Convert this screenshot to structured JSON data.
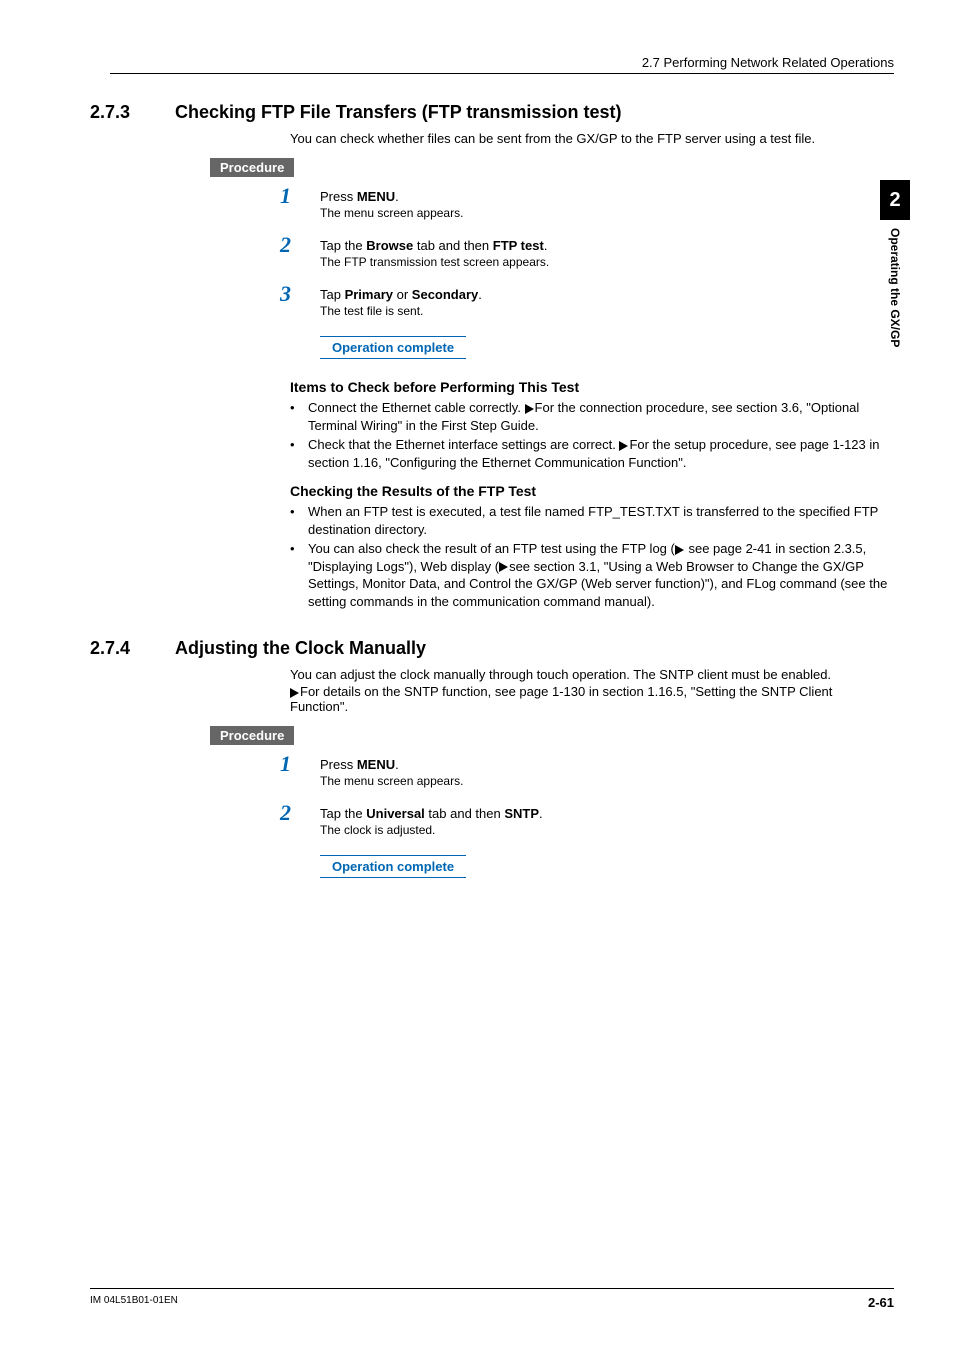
{
  "header": {
    "section_label": "2.7  Performing Network Related Operations"
  },
  "side_tab": {
    "number": "2",
    "text": "Operating the GX/GP"
  },
  "sec273": {
    "num": "2.7.3",
    "title": "Checking FTP File Transfers (FTP transmission test)",
    "intro": "You can check whether files can be sent from the GX/GP to the FTP server using a test file.",
    "procedure_label": "Procedure",
    "steps": [
      {
        "n": "1",
        "main_pre": "Press ",
        "main_bold": "MENU",
        "main_post": ".",
        "sub": "The menu screen appears."
      },
      {
        "n": "2",
        "main_pre": "Tap the ",
        "main_bold": "Browse",
        "main_mid": " tab and then ",
        "main_bold2": "FTP test",
        "main_post": ".",
        "sub": "The FTP transmission test screen appears."
      },
      {
        "n": "3",
        "main_pre": "Tap ",
        "main_bold": "Primary",
        "main_mid": " or ",
        "main_bold2": "Secondary",
        "main_post": ".",
        "sub": "The test file is sent."
      }
    ],
    "op_complete": "Operation complete",
    "check_before_head": "Items to Check before Performing This Test",
    "check_before": [
      "Connect the Ethernet cable correctly. ▶For the connection procedure, see section 3.6, \"Optional Terminal Wiring\" in the First Step Guide.",
      "Check that the Ethernet interface settings are correct. ▶For the setup procedure, see page 1-123 in section 1.16, \"Configuring the Ethernet Communication Function\"."
    ],
    "check_results_head": "Checking the Results of the FTP Test",
    "check_results": [
      "When an FTP test is executed, a test file named FTP_TEST.TXT is transferred to the specified FTP destination directory.",
      "You can also check the result of an FTP test using the FTP log (▶ see page 2-41 in section 2.3.5, \"Displaying Logs\"), Web display (▶see section 3.1, \"Using a Web Browser to Change the GX/GP Settings, Monitor Data, and Control the GX/GP (Web server function)\"), and FLog command (see the setting commands in the communication command manual)."
    ]
  },
  "sec274": {
    "num": "2.7.4",
    "title": "Adjusting the Clock Manually",
    "intro1": "You can adjust the clock manually through touch operation. The SNTP client must be enabled.",
    "intro2": "▶For details on the SNTP function, see page 1-130 in section 1.16.5, \"Setting the SNTP Client Function\".",
    "procedure_label": "Procedure",
    "steps": [
      {
        "n": "1",
        "main_pre": "Press ",
        "main_bold": "MENU",
        "main_post": ".",
        "sub": "The menu screen appears."
      },
      {
        "n": "2",
        "main_pre": "Tap the ",
        "main_bold": "Universal",
        "main_mid": " tab and then ",
        "main_bold2": "SNTP",
        "main_post": ".",
        "sub": "The clock is adjusted."
      }
    ],
    "op_complete": "Operation complete"
  },
  "footer": {
    "left": "IM 04L51B01-01EN",
    "right": "2-61"
  }
}
